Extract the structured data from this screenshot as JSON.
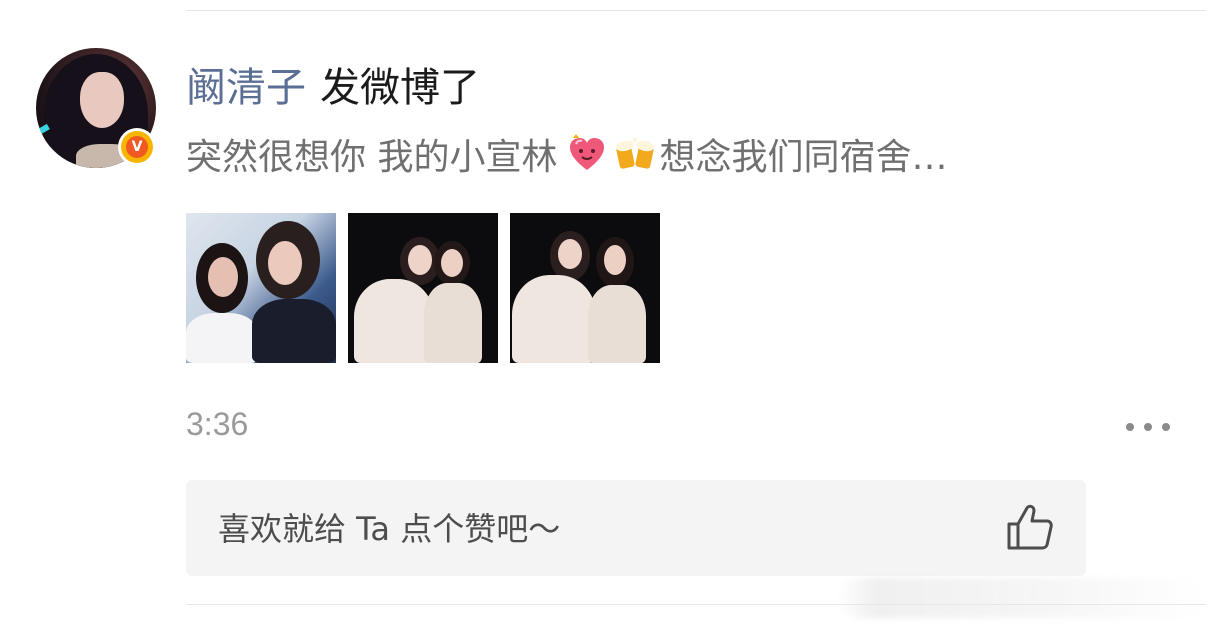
{
  "post": {
    "username": "阚清子",
    "action": "发微博了",
    "text_part1": "突然很想你 我的小宣林",
    "text_part2": "想念我们同宿舍…",
    "emoji1": "heart-face-emoji",
    "emoji2": "beer-cheers-emoji",
    "time": "3:36",
    "photo_count": 3
  },
  "like_bar": {
    "prompt": "喜欢就给 Ta 点个赞吧～",
    "icon": "thumbs-up-icon"
  },
  "colors": {
    "username": "#5b6f95",
    "body_text": "#707070",
    "verified_badge": "#f7b500",
    "timestamp": "#9a9a9a",
    "like_bar_bg": "#f4f4f4"
  }
}
